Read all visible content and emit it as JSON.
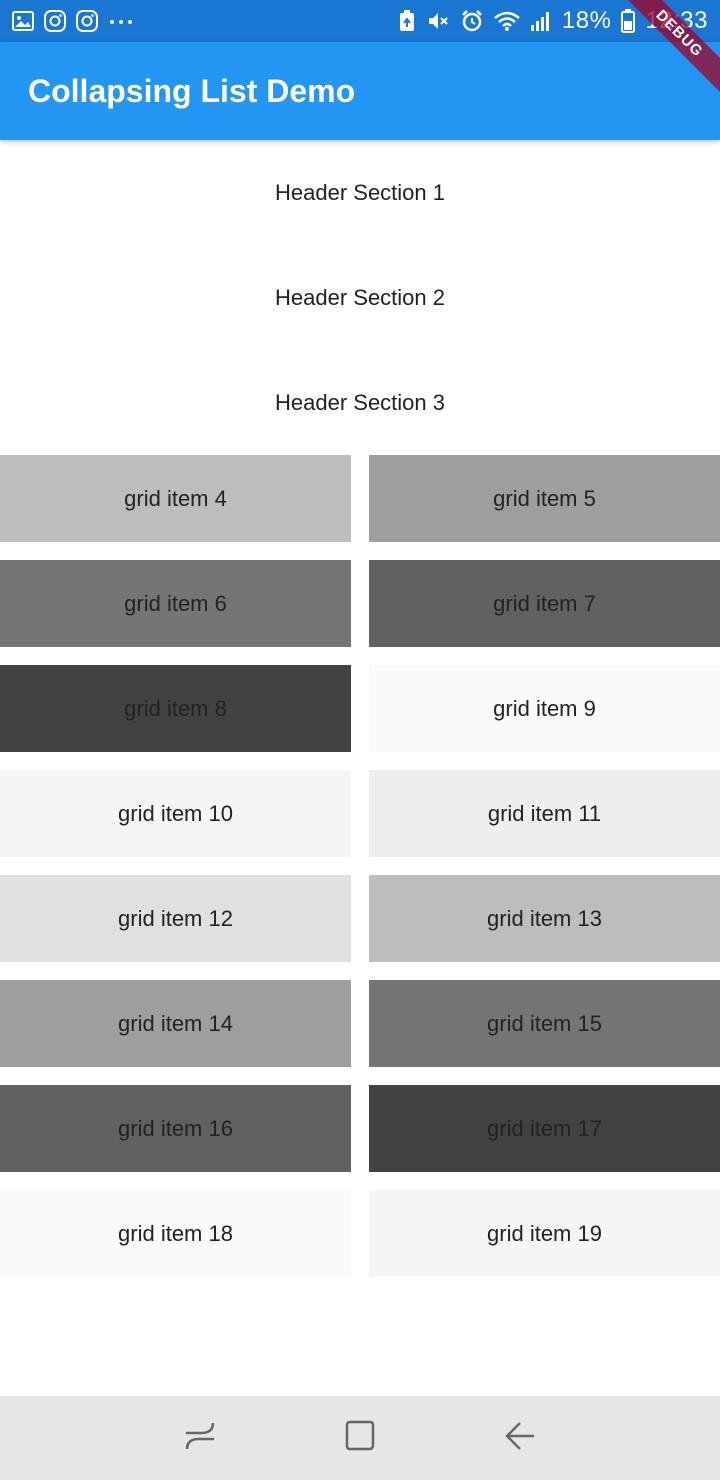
{
  "status_bar": {
    "battery": "18%",
    "time": "12:33",
    "left_icons": [
      "gallery-icon",
      "instagram-icon",
      "instagram-icon",
      "more-dots-icon"
    ],
    "right_icons": [
      "battery-saver-icon",
      "mute-icon",
      "alarm-icon",
      "wifi-icon",
      "signal-icon",
      "battery-icon"
    ]
  },
  "app_bar": {
    "title": "Collapsing List Demo",
    "color": "#2196F3"
  },
  "debug_banner": "DEBUG",
  "headers": [
    {
      "label": "Header Section 1"
    },
    {
      "label": "Header Section 2"
    },
    {
      "label": "Header Section 3"
    }
  ],
  "grid_items": [
    {
      "label": "grid item 4",
      "color": "#BDBDBD"
    },
    {
      "label": "grid item 5",
      "color": "#9E9E9E"
    },
    {
      "label": "grid item 6",
      "color": "#757575"
    },
    {
      "label": "grid item 7",
      "color": "#616161"
    },
    {
      "label": "grid item 8",
      "color": "#424242"
    },
    {
      "label": "grid item 9",
      "color": "#FAFAFA"
    },
    {
      "label": "grid item 10",
      "color": "#F5F5F5"
    },
    {
      "label": "grid item 11",
      "color": "#EEEEEE"
    },
    {
      "label": "grid item 12",
      "color": "#E0E0E0"
    },
    {
      "label": "grid item 13",
      "color": "#BDBDBD"
    },
    {
      "label": "grid item 14",
      "color": "#9E9E9E"
    },
    {
      "label": "grid item 15",
      "color": "#757575"
    },
    {
      "label": "grid item 16",
      "color": "#616161"
    },
    {
      "label": "grid item 17",
      "color": "#424242"
    },
    {
      "label": "grid item 18",
      "color": "#FAFAFA"
    },
    {
      "label": "grid item 19",
      "color": "#F5F5F5"
    }
  ],
  "nav_bar": {
    "buttons": [
      "recents-icon",
      "home-icon",
      "back-icon"
    ]
  }
}
